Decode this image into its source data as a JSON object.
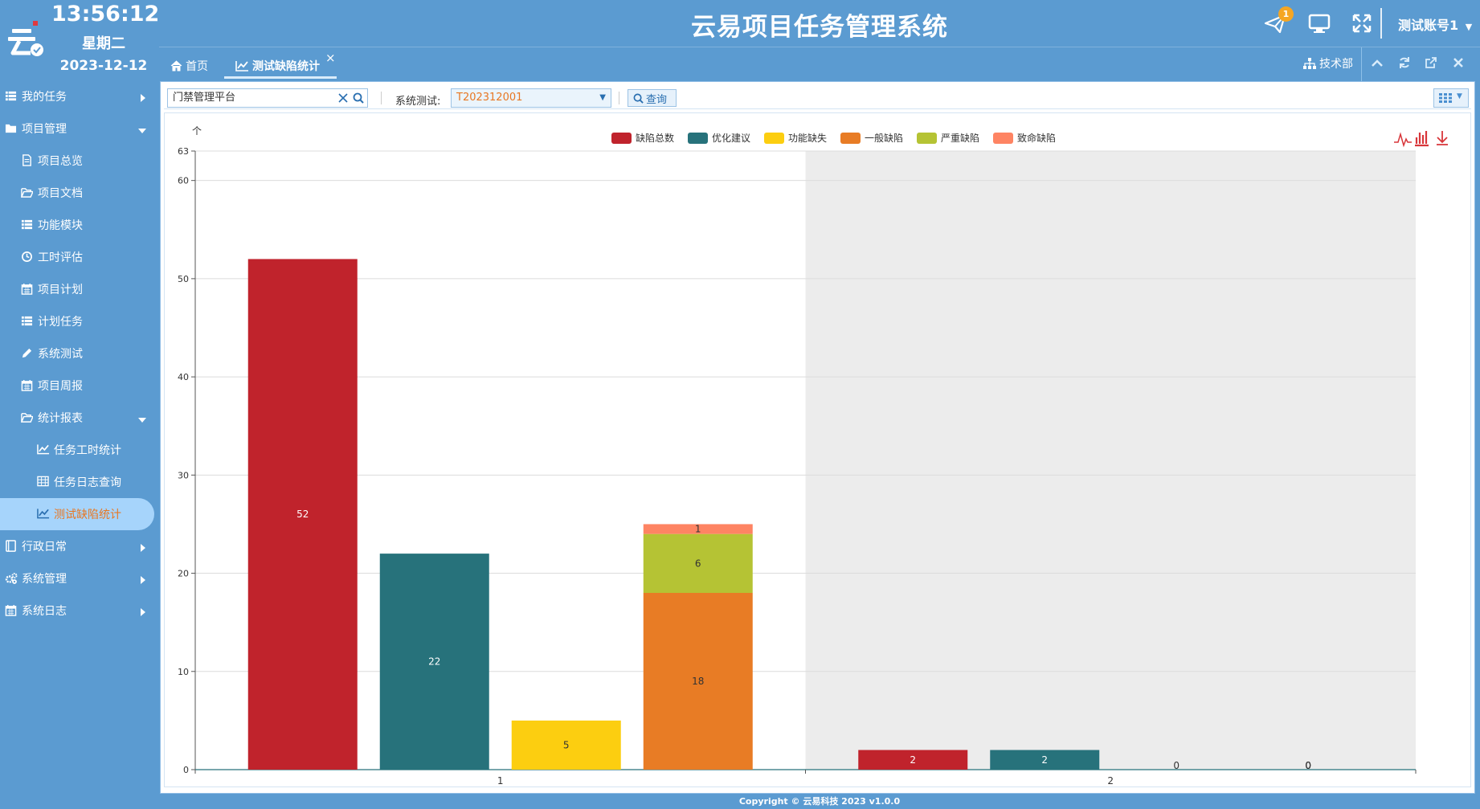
{
  "header": {
    "clock_time": "13:56:12",
    "clock_weekday": "星期二",
    "clock_date": "2023-12-12",
    "title": "云易项目任务管理系统",
    "notification_count": "1",
    "account": "测试账号1"
  },
  "sidebar": {
    "items": [
      {
        "label": "我的任务",
        "icon": "list-icon",
        "level": 1,
        "arrow": "right"
      },
      {
        "label": "项目管理",
        "icon": "folder-icon",
        "level": 1,
        "arrow": "down"
      },
      {
        "label": "项目总览",
        "icon": "file-icon",
        "level": 2
      },
      {
        "label": "项目文档",
        "icon": "folder-open-icon",
        "level": 2
      },
      {
        "label": "功能模块",
        "icon": "list-icon",
        "level": 2
      },
      {
        "label": "工时评估",
        "icon": "clock-icon",
        "level": 2
      },
      {
        "label": "项目计划",
        "icon": "calendar-icon",
        "level": 2
      },
      {
        "label": "计划任务",
        "icon": "list-icon",
        "level": 2
      },
      {
        "label": "系统测试",
        "icon": "pencil-icon",
        "level": 2
      },
      {
        "label": "项目周报",
        "icon": "calendar-icon",
        "level": 2
      },
      {
        "label": "统计报表",
        "icon": "folder-open-icon",
        "level": 2,
        "arrow": "down"
      },
      {
        "label": "任务工时统计",
        "icon": "line-chart-icon",
        "level": 3
      },
      {
        "label": "任务日志查询",
        "icon": "table-icon",
        "level": 3
      },
      {
        "label": "测试缺陷统计",
        "icon": "line-chart-icon",
        "level": 3,
        "active": true
      },
      {
        "label": "行政日常",
        "icon": "book-icon",
        "level": 1,
        "arrow": "right"
      },
      {
        "label": "系统管理",
        "icon": "gears-icon",
        "level": 1,
        "arrow": "right"
      },
      {
        "label": "系统日志",
        "icon": "calendar-icon",
        "level": 1,
        "arrow": "right"
      }
    ]
  },
  "tabs": {
    "home": "首页",
    "current": "测试缺陷统计",
    "close": "×",
    "department": "技术部"
  },
  "toolbar": {
    "project": "门禁管理平台",
    "test_label": "系统测试:",
    "test_value": "T202312001",
    "query": "查询"
  },
  "chart_data": {
    "type": "bar",
    "categories": [
      "1",
      "2"
    ],
    "ylim": [
      0,
      63
    ],
    "yticks": [
      0,
      10,
      20,
      30,
      40,
      50,
      60,
      63
    ],
    "y_arrow_label": "个",
    "legend_position": "top-center",
    "grid": true,
    "series": [
      {
        "name": "缺陷总数",
        "color": "#c0232c",
        "stack": "total",
        "values": [
          52,
          2
        ]
      },
      {
        "name": "优化建议",
        "color": "#27727b",
        "stack": "suggest",
        "values": [
          22,
          2
        ]
      },
      {
        "name": "功能缺失",
        "color": "#fcce10",
        "stack": "missing",
        "values": [
          5,
          0
        ]
      },
      {
        "name": "一般缺陷",
        "color": "#e87c25",
        "stack": "defect",
        "values": [
          18,
          0
        ]
      },
      {
        "name": "严重缺陷",
        "color": "#b5c334",
        "stack": "defect",
        "values": [
          6,
          0
        ]
      },
      {
        "name": "致命缺陷",
        "color": "#fe8463",
        "stack": "defect",
        "values": [
          1,
          0
        ]
      }
    ],
    "highlight_category": "2"
  },
  "footer": {
    "copyright": "Copyright © 云易科技 2023 v1.0.0"
  }
}
